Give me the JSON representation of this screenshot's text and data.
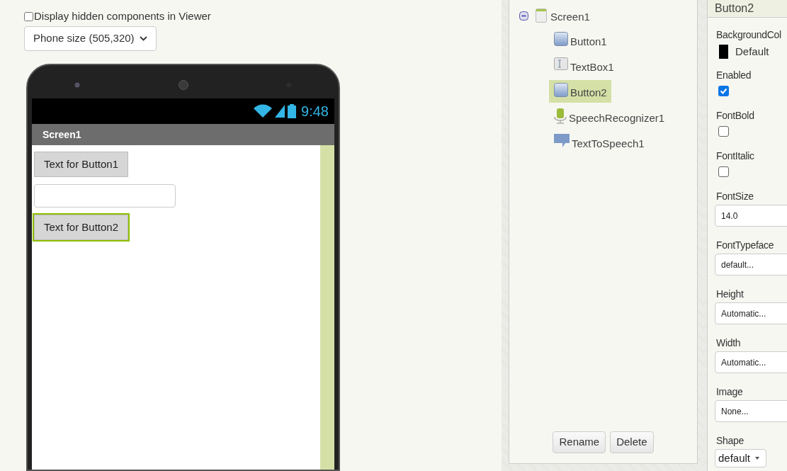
{
  "viewer": {
    "hidden_toggle": {
      "label": "Display hidden components in Viewer",
      "checked": false
    },
    "size_select": {
      "value": "Phone size (505,320)"
    },
    "phone": {
      "time": "9:48",
      "title": "Screen1",
      "components": [
        {
          "kind": "button",
          "text": "Text for Button1",
          "selected": false
        },
        {
          "kind": "textbox",
          "selected": false
        },
        {
          "kind": "button",
          "text": "Text for Button2",
          "selected": true
        }
      ]
    }
  },
  "components": {
    "root": {
      "label": "Screen1",
      "kind": "screen",
      "expanded": true,
      "selected": false,
      "children": [
        {
          "label": "Button1",
          "kind": "button",
          "selected": false
        },
        {
          "label": "TextBox1",
          "kind": "textbox",
          "selected": false
        },
        {
          "label": "Button2",
          "kind": "button",
          "selected": true
        },
        {
          "label": "SpeechRecognizer1",
          "kind": "speech",
          "selected": false
        },
        {
          "label": "TextToSpeech1",
          "kind": "tts",
          "selected": false
        }
      ]
    },
    "buttons": [
      "Rename",
      "Delete"
    ]
  },
  "properties": {
    "title": "Button2",
    "items": [
      {
        "kind": "color",
        "label": "BackgroundCol",
        "value": "Default",
        "color": "#000000"
      },
      {
        "kind": "checkbox",
        "label": "Enabled",
        "checked": true
      },
      {
        "kind": "checkbox",
        "label": "FontBold",
        "checked": false
      },
      {
        "kind": "checkbox",
        "label": "FontItalic",
        "checked": false
      },
      {
        "kind": "text",
        "label": "FontSize",
        "value": "14.0"
      },
      {
        "kind": "chooser",
        "label": "FontTypeface",
        "value": "default..."
      },
      {
        "kind": "chooser",
        "label": "Height",
        "value": "Automatic..."
      },
      {
        "kind": "chooser",
        "label": "Width",
        "value": "Automatic..."
      },
      {
        "kind": "chooser",
        "label": "Image",
        "value": "None..."
      },
      {
        "kind": "dropdown",
        "label": "Shape",
        "value": "default"
      }
    ]
  }
}
